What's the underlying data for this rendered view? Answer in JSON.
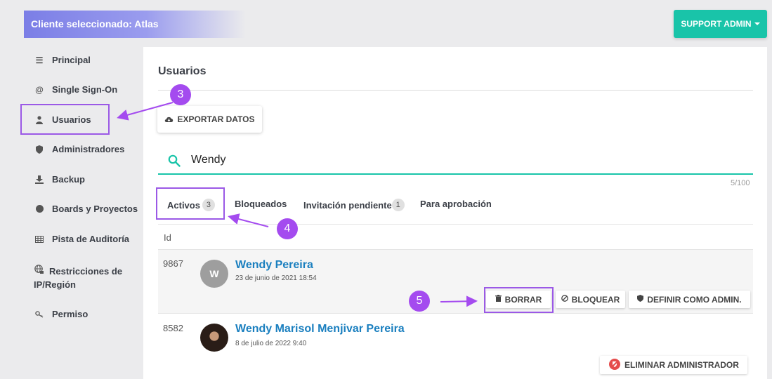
{
  "header": {
    "client_label": "Cliente seleccionado: Atlas",
    "support_label": "SUPPORT ADMIN"
  },
  "sidebar": {
    "items": [
      {
        "label": "Principal",
        "icon": "sliders-icon"
      },
      {
        "label": "Single Sign-On",
        "icon": "at-icon"
      },
      {
        "label": "Usuarios",
        "icon": "user-icon"
      },
      {
        "label": "Administradores",
        "icon": "shield-icon"
      },
      {
        "label": "Backup",
        "icon": "download-icon"
      },
      {
        "label": "Boards y Proyectos",
        "icon": "circle-icon"
      },
      {
        "label": "Pista de Auditoría",
        "icon": "table-icon"
      },
      {
        "label": "Restricciones de IP/Región",
        "icon": "globe-lock-icon"
      },
      {
        "label": "Permiso",
        "icon": "key-icon"
      }
    ]
  },
  "main": {
    "title": "Usuarios",
    "export_label": "EXPORTAR DATOS",
    "search": {
      "value": "Wendy",
      "counter": "5/100"
    },
    "tabs": [
      {
        "label": "Activos",
        "badge": "3"
      },
      {
        "label": "Bloqueados",
        "badge": ""
      },
      {
        "label": "Invitación pendiente",
        "badge": "1"
      },
      {
        "label": "Para aprobación",
        "badge": ""
      }
    ],
    "column_id": "Id",
    "users": [
      {
        "id": "9867",
        "initial": "W",
        "name": "Wendy Pereira",
        "date": "23 de junio de 2021 18:54"
      },
      {
        "id": "8582",
        "initial": "",
        "name": "Wendy Marisol Menjivar Pereira",
        "date": "8 de julio de 2022 9:40"
      }
    ],
    "actions": {
      "delete": "BORRAR",
      "block": "BLOQUEAR",
      "make_admin": "DEFINIR COMO ADMIN.",
      "remove_admin": "ELIMINAR ADMINISTRADOR"
    }
  },
  "annotations": {
    "step3": "3",
    "step4": "4",
    "step5": "5"
  },
  "colors": {
    "accent": "#19c4a9",
    "marker": "#a44bef",
    "link": "#1a7fbf",
    "header_gradient": "#7b7ee6"
  }
}
